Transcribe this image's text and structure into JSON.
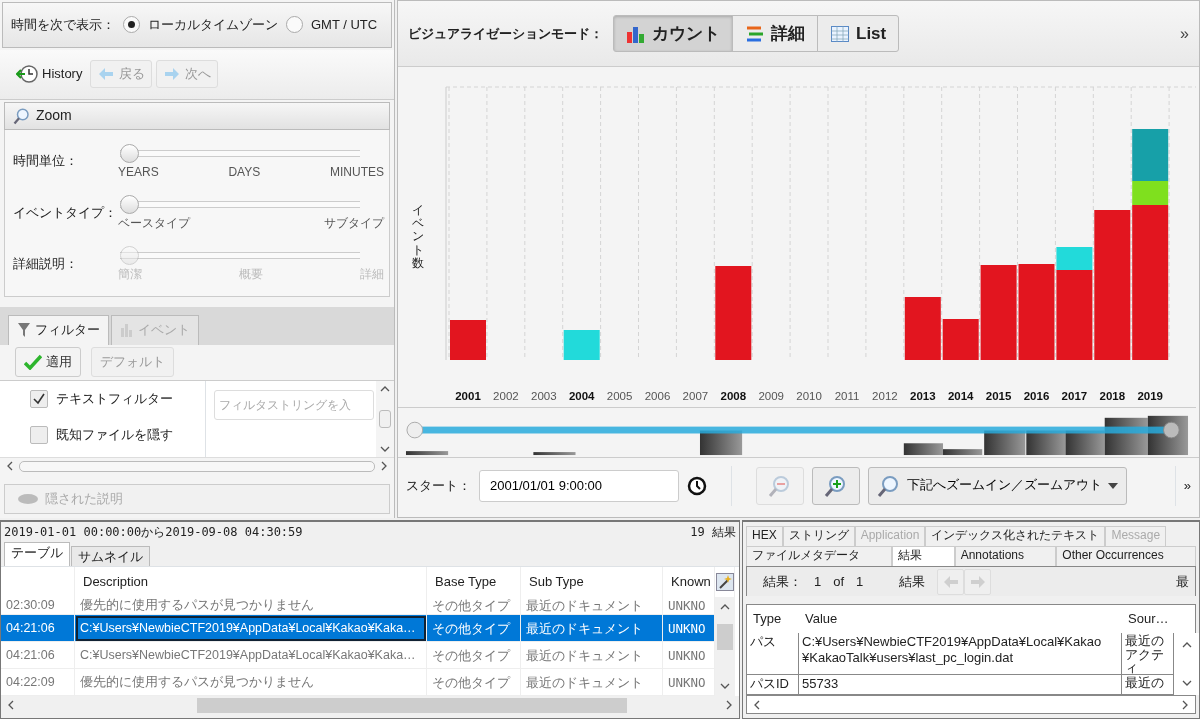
{
  "time_display": {
    "label": "時間を次で表示：",
    "options": [
      {
        "label": "ローカルタイムゾーン",
        "selected": true
      },
      {
        "label": "GMT / UTC",
        "selected": false
      }
    ]
  },
  "history": {
    "label": "History",
    "buttons": [
      {
        "label": "戻る",
        "disabled": true
      },
      {
        "label": "次へ",
        "disabled": true
      }
    ]
  },
  "zoom": {
    "title": "Zoom",
    "sliders": [
      {
        "label": "時間単位：",
        "level": 0,
        "disabled": false,
        "ticks": [
          "YEARS",
          "DAYS",
          "MINUTES"
        ]
      },
      {
        "label": "イベントタイプ：",
        "level": 0,
        "disabled": false,
        "ticks": [
          "ベースタイプ",
          "サブタイプ"
        ]
      },
      {
        "label": "詳細説明：",
        "level": 0,
        "disabled": true,
        "ticks": [
          "簡潔",
          "概要",
          "詳細"
        ]
      }
    ]
  },
  "filter_panel": {
    "tabs": [
      {
        "label": "フィルター",
        "selected": true,
        "disabled": false
      },
      {
        "label": "イベント",
        "selected": false,
        "disabled": true
      }
    ],
    "buttons": [
      {
        "label": "適用",
        "disabled": false
      },
      {
        "label": "デフォルト",
        "disabled": true
      }
    ],
    "filters": [
      {
        "label": "テキストフィルター",
        "checked": true
      },
      {
        "label": "既知ファイルを隠す",
        "checked": false
      }
    ],
    "search": {
      "placeholder": "フィルタストリングを入"
    }
  },
  "hidden_descriptions": {
    "label": "隠された説明",
    "disabled": true
  },
  "visualization": {
    "label": "ビジュアライゼーションモード：",
    "modes": [
      {
        "label": "カウント",
        "selected": true
      },
      {
        "label": "詳細",
        "selected": false
      },
      {
        "label": "List",
        "selected": false
      }
    ],
    "overflow": "»"
  },
  "chart": {
    "ylabel": "イベント数",
    "years": [
      {
        "label": "2001",
        "bold": true
      },
      {
        "label": "2002",
        "bold": false
      },
      {
        "label": "2003",
        "bold": false
      },
      {
        "label": "2004",
        "bold": true
      },
      {
        "label": "2005",
        "bold": false
      },
      {
        "label": "2006",
        "bold": false
      },
      {
        "label": "2007",
        "bold": false
      },
      {
        "label": "2008",
        "bold": true
      },
      {
        "label": "2009",
        "bold": false
      },
      {
        "label": "2010",
        "bold": false
      },
      {
        "label": "2011",
        "bold": false
      },
      {
        "label": "2012",
        "bold": false
      },
      {
        "label": "2013",
        "bold": true
      },
      {
        "label": "2014",
        "bold": true
      },
      {
        "label": "2015",
        "bold": true
      },
      {
        "label": "2016",
        "bold": true
      },
      {
        "label": "2017",
        "bold": true
      },
      {
        "label": "2018",
        "bold": true
      },
      {
        "label": "2019",
        "bold": true
      }
    ]
  },
  "range_slider": {
    "thumbs": [
      {
        "level": 0
      },
      {
        "level": 1
      }
    ]
  },
  "range_toolbar": {
    "start_label": "スタート：",
    "start_value": "2001/01/01 9:00:00",
    "zoom_out_disabled": true,
    "zoom_menu": "下記へズームイン／ズームアウト",
    "overflow": "»"
  },
  "results": {
    "range": "2019-01-01 00:00:00から2019-09-08 04:30:59",
    "count": "19 結果",
    "tabs": [
      {
        "label": "テーブル",
        "selected": true
      },
      {
        "label": "サムネイル",
        "selected": false
      }
    ],
    "columns": [
      "Description",
      "Base Type",
      "Sub Type",
      "Known"
    ],
    "rows": [
      {
        "time": "02:30:09",
        "description": "優先的に使用するパスが見つかりません",
        "base_type": "その他タイプ",
        "sub_type": "最近のドキュメント",
        "known": "UNKNO",
        "selected": false
      },
      {
        "time": "04:21:06",
        "description": "C:¥Users¥NewbieCTF2019¥AppData¥Local¥Kakao¥Kaka…",
        "base_type": "その他タイプ",
        "sub_type": "最近のドキュメント",
        "known": "UNKNO",
        "selected": true
      },
      {
        "time": "04:21:06",
        "description": "C:¥Users¥NewbieCTF2019¥AppData¥Local¥Kakao¥Kaka…",
        "base_type": "その他タイプ",
        "sub_type": "最近のドキュメント",
        "known": "UNKNO",
        "selected": false
      },
      {
        "time": "04:22:09",
        "description": "優先的に使用するパスが見つかりません",
        "base_type": "その他タイプ",
        "sub_type": "最近のドキュメント",
        "known": "UNKNO",
        "selected": false
      }
    ]
  },
  "details": {
    "tab_rows": [
      [
        {
          "label": "HEX",
          "selected": false,
          "disabled": false
        },
        {
          "label": "ストリング",
          "selected": false,
          "disabled": false
        },
        {
          "label": "Application",
          "selected": false,
          "disabled": true
        },
        {
          "label": "インデックス化されたテキスト",
          "selected": false,
          "disabled": false
        },
        {
          "label": "Message",
          "selected": false,
          "disabled": true
        }
      ],
      [
        {
          "label": "ファイルメタデータ",
          "selected": false,
          "disabled": false
        },
        {
          "label": "結果",
          "selected": true,
          "disabled": false
        },
        {
          "label": "Annotations",
          "selected": false,
          "disabled": false
        },
        {
          "label": "Other Occurrences",
          "selected": false,
          "disabled": false
        }
      ]
    ],
    "nav": {
      "label": "結果：",
      "current": "1",
      "of": "of",
      "total": "1",
      "unit": "結果",
      "arrows": [
        {
          "disabled": true
        },
        {
          "disabled": true
        }
      ],
      "cut_text": "最"
    },
    "columns": [
      "Type",
      "Value",
      "Sour…"
    ],
    "rows": [
      {
        "type": "パス",
        "value": "C:¥Users¥NewbieCTF2019¥AppData¥Local¥Kakao ¥KakaoTalk¥users¥last_pc_login.dat",
        "source": "最近のアクティ"
      },
      {
        "type": "パスID",
        "value": "55733",
        "source": "最近の"
      }
    ]
  }
}
